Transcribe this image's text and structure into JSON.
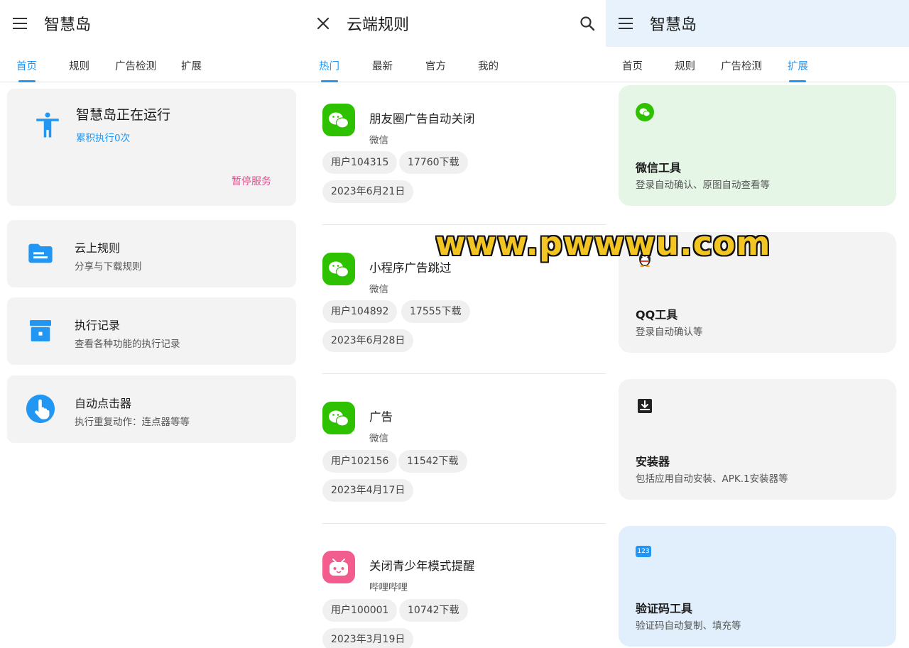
{
  "panel_home": {
    "title": "智慧岛",
    "menu_icon": "hamburger-menu-icon",
    "tabs": [
      {
        "label": "首页",
        "active": true
      },
      {
        "label": "规则",
        "active": false
      },
      {
        "label": "广告检测",
        "active": false
      },
      {
        "label": "扩展",
        "active": false
      }
    ],
    "status": {
      "icon": "accessibility-icon",
      "title": "智慧岛正在运行",
      "subtitle": "累积执行0次",
      "action": "暂停服务"
    },
    "menu": [
      {
        "icon": "folder-icon",
        "title": "云上规则",
        "subtitle": "分享与下载规则"
      },
      {
        "icon": "archive-box-icon",
        "title": "执行记录",
        "subtitle": "查看各种功能的执行记录"
      },
      {
        "icon": "tap-hand-icon",
        "title": "自动点击器",
        "subtitle": "执行重复动作：连点器等等"
      }
    ]
  },
  "panel_cloud": {
    "title": "云端规则",
    "close_icon": "close-icon",
    "search_icon": "search-icon",
    "tabs": [
      {
        "label": "热门",
        "active": true
      },
      {
        "label": "最新",
        "active": false
      },
      {
        "label": "官方",
        "active": false
      },
      {
        "label": "我的",
        "active": false
      }
    ],
    "rules": [
      {
        "icon": "wechat-app-icon",
        "title": "朋友圈广告自动关闭",
        "app": "微信",
        "user": "用户104315",
        "downloads": "17760下载",
        "date": "2023年6月21日"
      },
      {
        "icon": "wechat-app-icon",
        "title": "小程序广告跳过",
        "app": "微信",
        "user": "用户104892",
        "downloads": "17555下载",
        "date": "2023年6月28日"
      },
      {
        "icon": "wechat-app-icon",
        "title": "广告",
        "app": "微信",
        "user": "用户102156",
        "downloads": "11542下载",
        "date": "2023年4月17日"
      },
      {
        "icon": "bilibili-app-icon",
        "title": "关闭青少年模式提醒",
        "app": "哔哩哔哩",
        "user": "用户100001",
        "downloads": "10742下载",
        "date": "2023年3月19日"
      }
    ]
  },
  "panel_ext": {
    "title": "智慧岛",
    "menu_icon": "hamburger-menu-icon",
    "tabs": [
      {
        "label": "首页",
        "active": false
      },
      {
        "label": "规则",
        "active": false
      },
      {
        "label": "广告检测",
        "active": false
      },
      {
        "label": "扩展",
        "active": true
      }
    ],
    "extensions": [
      {
        "icon": "wechat-icon",
        "title": "微信工具",
        "subtitle": "登录自动确认、原图自动查看等",
        "bg": "#e6f6e6"
      },
      {
        "icon": "qq-penguin-icon",
        "title": "QQ工具",
        "subtitle": "登录自动确认等",
        "bg": "#f3f3f3"
      },
      {
        "icon": "installer-download-icon",
        "title": "安装器",
        "subtitle": "包括应用自动安装、APK.1安装器等",
        "bg": "#f3f3f3"
      },
      {
        "icon": "verification-code-icon",
        "title": "验证码工具",
        "subtitle": "验证码自动复制、填充等",
        "bg": "#e1effc"
      }
    ],
    "code_icon_text": "123"
  },
  "watermark": "www.pwwwu.com",
  "colors": {
    "accent": "#2196f3",
    "pause": "#e4508c",
    "wechat": "#2dc100",
    "bilibili": "#f25d8e"
  }
}
